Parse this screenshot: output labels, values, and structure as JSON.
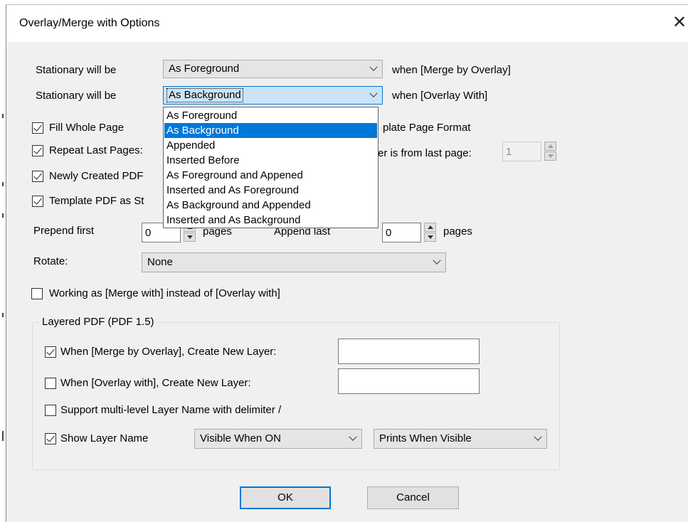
{
  "dialog": {
    "title": "Overlay/Merge with Options",
    "close_glyph": "✕"
  },
  "stationary1": {
    "label": "Stationary will be",
    "value": "As Foreground",
    "suffix": "when [Merge by Overlay]"
  },
  "stationary2": {
    "label": "Stationary will be",
    "value": "As Background",
    "suffix": "when [Overlay With]",
    "options": [
      "As Foreground",
      "As Background",
      "Appended",
      "Inserted Before",
      "As Foreground and Appened",
      "Inserted and As Foreground",
      "As Background and Appended",
      "Inserted and As Background"
    ],
    "selected_index": 1
  },
  "checks": {
    "fill_whole_page": {
      "label": "Fill Whole Page",
      "checked": true
    },
    "template_page_format": {
      "label_visible": "plate Page Format"
    },
    "repeat_last_pages": {
      "label": "Repeat Last Pages:",
      "checked": true
    },
    "last_page_text": "er is from last page:",
    "last_page_value": "1",
    "newly_created_pdf": {
      "label": "Newly Created PDF",
      "checked": true
    },
    "template_pdf_as": {
      "label": "Template PDF as St",
      "checked": true
    }
  },
  "prepend": {
    "label": "Prepend first",
    "value": "0",
    "unit": "pages"
  },
  "append": {
    "label": "Append last",
    "value": "0",
    "unit": "pages"
  },
  "rotate": {
    "label": "Rotate:",
    "value": "None"
  },
  "working_as": {
    "label": "Working as [Merge with] instead of [Overlay with]",
    "checked": false
  },
  "layered": {
    "group_label": "Layered PDF (PDF 1.5)",
    "merge_by_overlay": {
      "label": "When [Merge by Overlay], Create New Layer:",
      "checked": true,
      "value": ""
    },
    "overlay_with": {
      "label": "When [Overlay with], Create New Layer:",
      "checked": false,
      "value": ""
    },
    "multilevel": {
      "label": "Support multi-level Layer Name with delimiter /",
      "checked": false
    },
    "show_layer_name": {
      "label": "Show Layer Name",
      "checked": true
    },
    "visibility": {
      "value": "Visible When ON"
    },
    "printing": {
      "value": "Prints When Visible"
    }
  },
  "buttons": {
    "ok": "OK",
    "cancel": "Cancel"
  }
}
